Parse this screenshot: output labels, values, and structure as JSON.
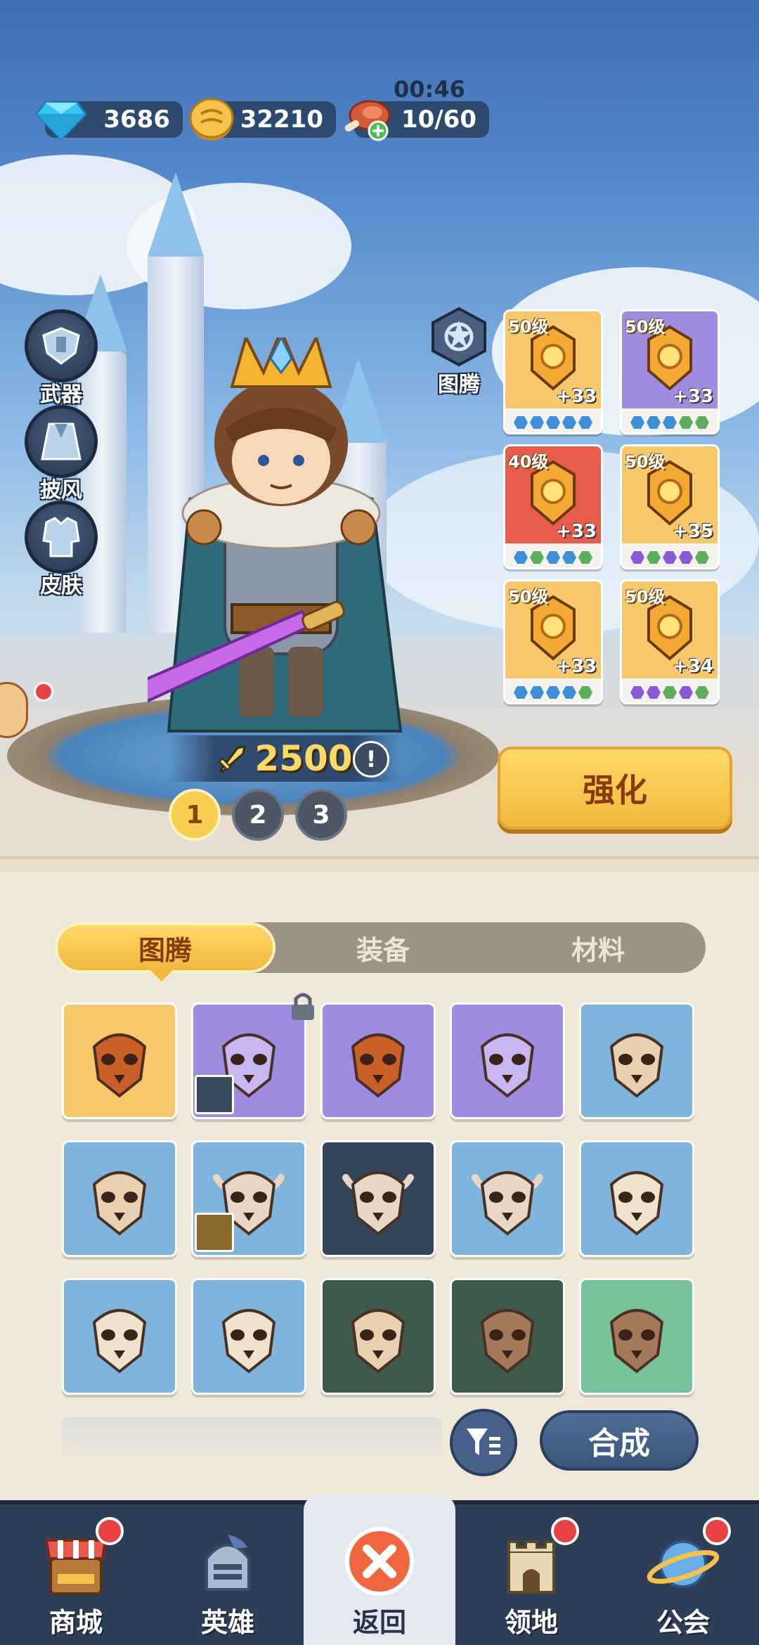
{
  "resources": {
    "diamonds": "3686",
    "gold": "32210",
    "stamina": "10/60",
    "stamina_timer": "00:46"
  },
  "side_buttons": [
    {
      "label": "武器",
      "icon": "weapon-icon"
    },
    {
      "label": "披风",
      "icon": "cape-icon"
    },
    {
      "label": "皮肤",
      "icon": "skin-icon"
    }
  ],
  "totem_button": {
    "label": "图腾",
    "icon": "totem-icon"
  },
  "gear": [
    {
      "level": "50级",
      "plus": "+33",
      "bg": "#f6c86b",
      "dots": [
        "#3f8fd8",
        "#3f8fd8",
        "#3f8fd8",
        "#3f8fd8",
        "#3f8fd8"
      ]
    },
    {
      "level": "50级",
      "plus": "+33",
      "bg": "#9f8ce0",
      "dots": [
        "#3f8fd8",
        "#3f8fd8",
        "#3f8fd8",
        "#5cae5c",
        "#5cae5c"
      ]
    },
    {
      "level": "40级",
      "plus": "+33",
      "bg": "#e85c4d",
      "dots": [
        "#3f8fd8",
        "#5cae5c",
        "#3f8fd8",
        "#3f8fd8",
        "#5cae5c"
      ]
    },
    {
      "level": "50级",
      "plus": "+35",
      "bg": "#f6c86b",
      "dots": [
        "#8a5ad6",
        "#5cae5c",
        "#8a5ad6",
        "#8a5ad6",
        "#5cae5c"
      ]
    },
    {
      "level": "50级",
      "plus": "+33",
      "bg": "#f6c86b",
      "dots": [
        "#3f8fd8",
        "#3f8fd8",
        "#3f8fd8",
        "#3f8fd8",
        "#5cae5c"
      ]
    },
    {
      "level": "50级",
      "plus": "+34",
      "bg": "#f6c86b",
      "dots": [
        "#8a5ad6",
        "#8a5ad6",
        "#5cae5c",
        "#8a5ad6",
        "#5cae5c"
      ]
    }
  ],
  "power": "2500",
  "info_mark": "!",
  "slots": [
    "1",
    "2",
    "3"
  ],
  "enhance_label": "强化",
  "tabs": [
    {
      "label": "图腾",
      "active": true
    },
    {
      "label": "装备",
      "active": false
    },
    {
      "label": "材料",
      "active": false
    }
  ],
  "totems": [
    {
      "name": "owl-gold",
      "color": "c-gold"
    },
    {
      "name": "bird-purple",
      "color": "c-purple"
    },
    {
      "name": "owl-purple",
      "color": "c-purple"
    },
    {
      "name": "beast-purple",
      "color": "c-purple"
    },
    {
      "name": "bear-blue",
      "color": "c-blue"
    },
    {
      "name": "bear-blue",
      "color": "c-blue"
    },
    {
      "name": "bull-blue",
      "color": "c-blue"
    },
    {
      "name": "bull-dark",
      "color": "c-dark"
    },
    {
      "name": "bull-blue",
      "color": "c-blue"
    },
    {
      "name": "cat-blue",
      "color": "c-blue"
    },
    {
      "name": "cat-blue",
      "color": "c-blue"
    },
    {
      "name": "cat-blue",
      "color": "c-blue"
    },
    {
      "name": "bear-dgreen",
      "color": "c-dgreen"
    },
    {
      "name": "eagle-dgreen",
      "color": "c-dgreen"
    },
    {
      "name": "eagle-green",
      "color": "c-green"
    }
  ],
  "merge_label": "合成",
  "nav": [
    {
      "label": "商城",
      "icon": "shop-icon",
      "badge": true
    },
    {
      "label": "英雄",
      "icon": "hero-helmet-icon",
      "badge": false
    },
    {
      "label": "返回",
      "icon": "close-icon",
      "badge": false,
      "active": true
    },
    {
      "label": "领地",
      "icon": "castle-icon",
      "badge": true
    },
    {
      "label": "公会",
      "icon": "planet-icon",
      "badge": true
    }
  ]
}
